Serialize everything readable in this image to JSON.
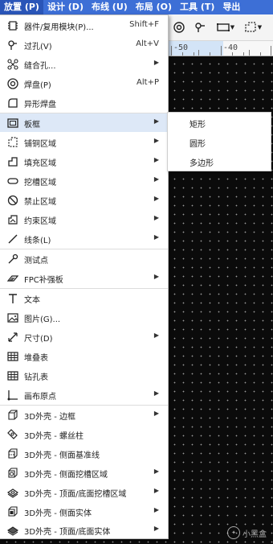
{
  "menubar": {
    "items": [
      {
        "label": "放置 (P)",
        "active": true
      },
      {
        "label": "设计 (D)"
      },
      {
        "label": "布线 (U)"
      },
      {
        "label": "布局 (O)"
      },
      {
        "label": "工具 (T)"
      },
      {
        "label": "导出"
      }
    ]
  },
  "ruler": {
    "labels": [
      "-50",
      "-40"
    ]
  },
  "place_menu": {
    "items": [
      {
        "label": "器件/复用模块(P)...",
        "shortcut": "Shift+F",
        "icon": "component-icon"
      },
      {
        "label": "过孔(V)",
        "shortcut": "Alt+V",
        "icon": "via-icon"
      },
      {
        "label": "缝合孔...",
        "icon": "stitching-via-icon",
        "submenu": true
      },
      {
        "label": "焊盘(P)",
        "shortcut": "Alt+P",
        "icon": "pad-icon"
      },
      {
        "label": "异形焊盘",
        "icon": "custom-pad-icon"
      },
      {
        "label": "板框",
        "icon": "board-outline-icon",
        "submenu": true,
        "highlighted": true
      },
      {
        "label": "铺铜区域",
        "icon": "copper-area-icon",
        "submenu": true
      },
      {
        "label": "填充区域",
        "icon": "fill-area-icon",
        "submenu": true
      },
      {
        "label": "挖槽区域",
        "icon": "slot-area-icon",
        "submenu": true
      },
      {
        "label": "禁止区域",
        "icon": "keepout-area-icon",
        "submenu": true
      },
      {
        "label": "约束区域",
        "icon": "constraint-area-icon",
        "submenu": true
      },
      {
        "label": "线条(L)",
        "icon": "line-icon",
        "submenu": true
      },
      {
        "label": "测试点",
        "icon": "test-point-icon"
      },
      {
        "label": "FPC补强板",
        "icon": "fpc-stiffener-icon",
        "submenu": true
      },
      {
        "label": "文本",
        "icon": "text-icon"
      },
      {
        "label": "图片(G)...",
        "icon": "image-icon"
      },
      {
        "label": "尺寸(D)",
        "icon": "dimension-icon",
        "submenu": true
      },
      {
        "label": "堆叠表",
        "icon": "stackup-table-icon"
      },
      {
        "label": "钻孔表",
        "icon": "drill-table-icon"
      },
      {
        "label": "画布原点",
        "icon": "canvas-origin-icon",
        "submenu": true
      },
      {
        "label": "3D外壳 - 边框",
        "icon": "3d-shell-frame-icon",
        "submenu": true
      },
      {
        "label": "3D外壳 - 螺丝柱",
        "icon": "3d-screw-post-icon"
      },
      {
        "label": "3D外壳 - 侧面基准线",
        "icon": "3d-side-baseline-icon"
      },
      {
        "label": "3D外壳 - 侧面挖槽区域",
        "icon": "3d-side-slot-icon",
        "submenu": true
      },
      {
        "label": "3D外壳 - 顶面/底面挖槽区域",
        "icon": "3d-top-bottom-slot-icon",
        "submenu": true
      },
      {
        "label": "3D外壳 - 侧面实体",
        "icon": "3d-side-solid-icon",
        "submenu": true
      },
      {
        "label": "3D外壳 - 顶面/底面实体",
        "icon": "3d-top-bottom-solid-icon",
        "submenu": true
      }
    ]
  },
  "board_outline_submenu": {
    "items": [
      {
        "label": "矩形"
      },
      {
        "label": "圆形"
      },
      {
        "label": "多边形"
      }
    ]
  },
  "watermark": {
    "text": "小黑盒"
  }
}
